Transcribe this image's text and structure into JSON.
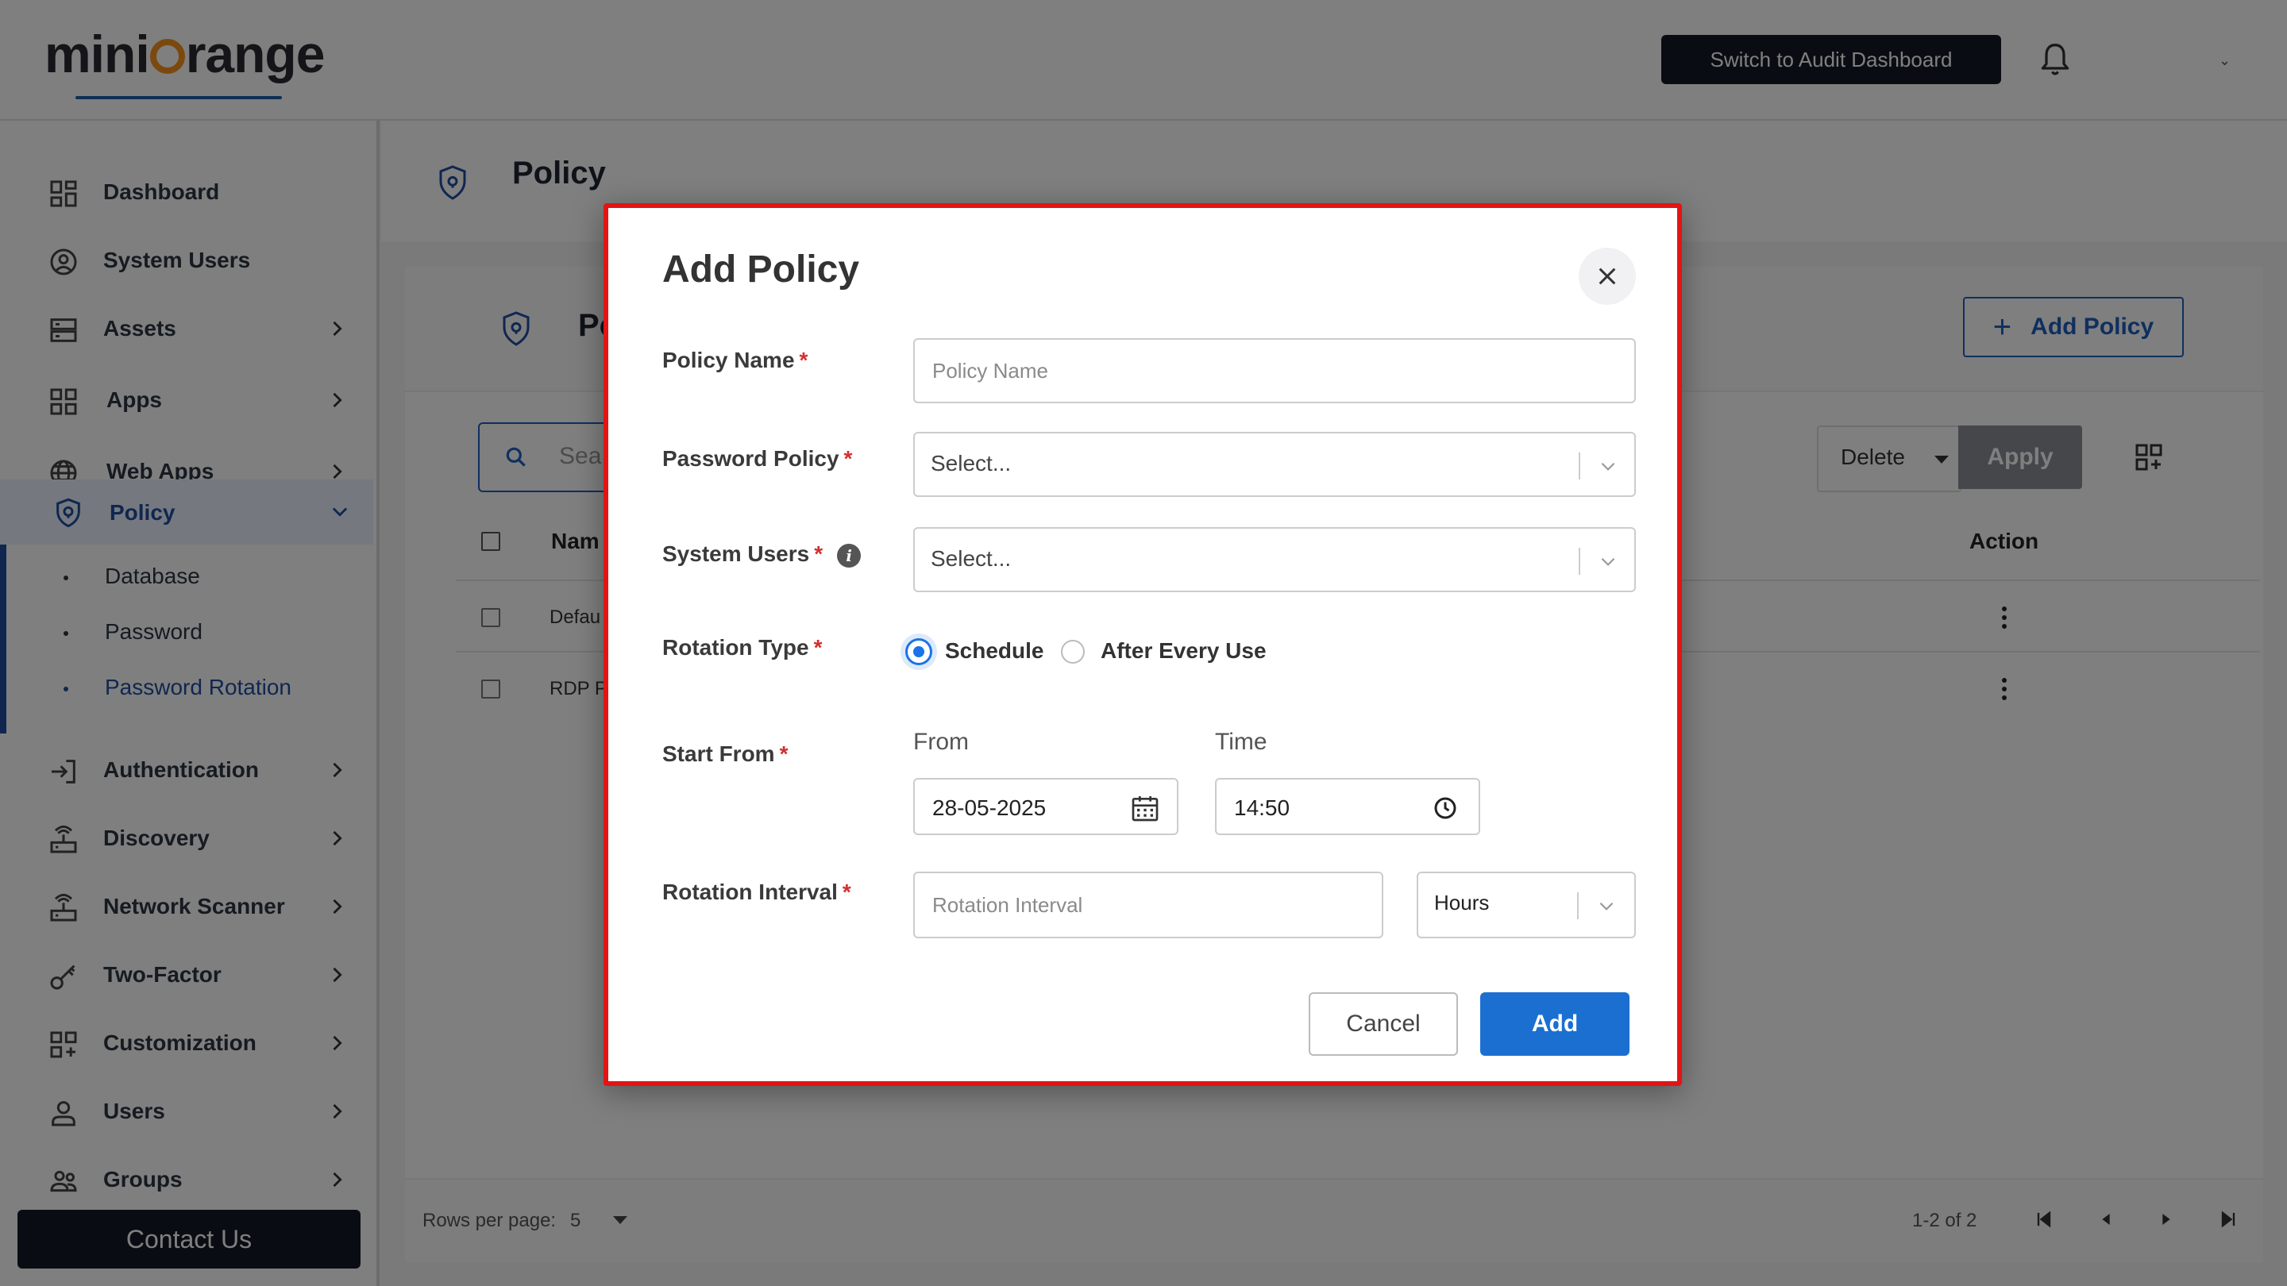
{
  "header": {
    "logo_text_left": "mini",
    "logo_text_right": "range",
    "audit_button": "Switch to Audit Dashboard"
  },
  "sidebar": {
    "items": [
      {
        "label": "Dashboard",
        "icon": "dashboard-icon"
      },
      {
        "label": "System Users",
        "icon": "user-circle-icon"
      },
      {
        "label": "Assets",
        "icon": "server-icon"
      },
      {
        "label": "Apps",
        "icon": "apps-icon"
      },
      {
        "label": "Web Apps",
        "icon": "globe-icon"
      },
      {
        "label": "Policy",
        "icon": "shield-icon",
        "active": true
      },
      {
        "label": "Authentication",
        "icon": "login-icon"
      },
      {
        "label": "Discovery",
        "icon": "router-icon"
      },
      {
        "label": "Network Scanner",
        "icon": "router-icon"
      },
      {
        "label": "Two-Factor",
        "icon": "key-icon"
      },
      {
        "label": "Customization",
        "icon": "customize-icon"
      },
      {
        "label": "Users",
        "icon": "user-icon"
      },
      {
        "label": "Groups",
        "icon": "group-icon"
      }
    ],
    "policy_sub": [
      "Database",
      "Password",
      "Password Rotation"
    ],
    "contact_button": "Contact Us"
  },
  "page": {
    "title": "Policy",
    "card_title": "Po",
    "add_policy_button": "Add Policy",
    "search_placeholder": "Sea",
    "delete_select": "Delete",
    "apply_button": "Apply",
    "columns": {
      "name": "Nam",
      "action": "Action"
    },
    "rows": [
      "Defau",
      "RDP P"
    ],
    "rows_per_page_label": "Rows per page:",
    "rows_per_page_value": "5",
    "range": "1-2 of 2"
  },
  "modal": {
    "title": "Add Policy",
    "policy_name_label": "Policy Name",
    "policy_name_placeholder": "Policy Name",
    "password_policy_label": "Password Policy",
    "password_policy_value": "Select...",
    "system_users_label": "System Users",
    "system_users_value": "Select...",
    "rotation_type_label": "Rotation Type",
    "rotation_options": [
      "Schedule",
      "After Every Use"
    ],
    "rotation_selected": "Schedule",
    "start_from_label": "Start From",
    "from_label": "From",
    "time_label": "Time",
    "date_value": "28-05-2025",
    "time_value": "14:50",
    "rotation_interval_label": "Rotation Interval",
    "rotation_interval_placeholder": "Rotation Interval",
    "interval_unit": "Hours",
    "required_mark": "*",
    "cancel_button": "Cancel",
    "add_button": "Add"
  },
  "colors": {
    "accent": "#1b6fd1",
    "modal_border": "#e21414",
    "dark_button": "#121a26",
    "logo_orange": "#f7931e"
  }
}
